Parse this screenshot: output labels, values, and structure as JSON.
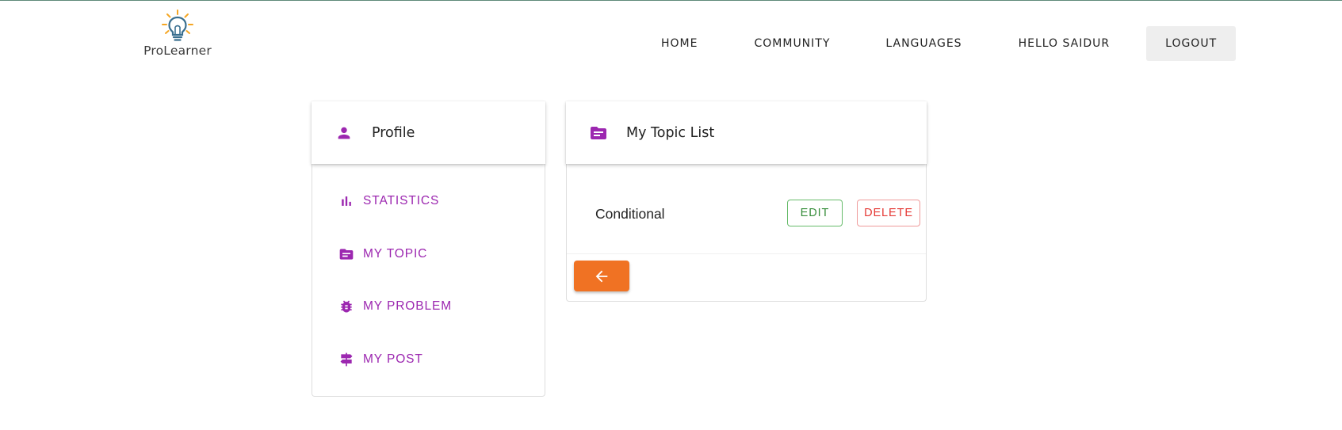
{
  "brand": {
    "name": "ProLearner",
    "accent": "#f5a623",
    "bulb_color": "#3a6f8f"
  },
  "nav": {
    "home": "HOME",
    "community": "COMMUNITY",
    "languages": "LANGUAGES",
    "greeting": "HELLO SAIDUR",
    "logout": "LOGOUT"
  },
  "profile": {
    "title": "Profile",
    "icon": "person-icon",
    "menu": [
      {
        "label": "STATISTICS",
        "icon": "bar-chart-icon"
      },
      {
        "label": "MY TOPIC",
        "icon": "topic-folder-icon"
      },
      {
        "label": "MY PROBLEM",
        "icon": "bug-icon"
      },
      {
        "label": "MY POST",
        "icon": "signpost-icon"
      }
    ]
  },
  "topics": {
    "title": "My Topic List",
    "icon": "topic-folder-icon",
    "items": [
      {
        "name": "Conditional",
        "edit_label": "EDIT",
        "delete_label": "DELETE"
      }
    ],
    "back_icon": "arrow-left-icon"
  },
  "colors": {
    "accent_purple": "#9c27b0",
    "edit_green": "#388e3c",
    "delete_red": "#e53935",
    "back_orange": "#f07223",
    "logout_bg": "#eeeeee"
  }
}
